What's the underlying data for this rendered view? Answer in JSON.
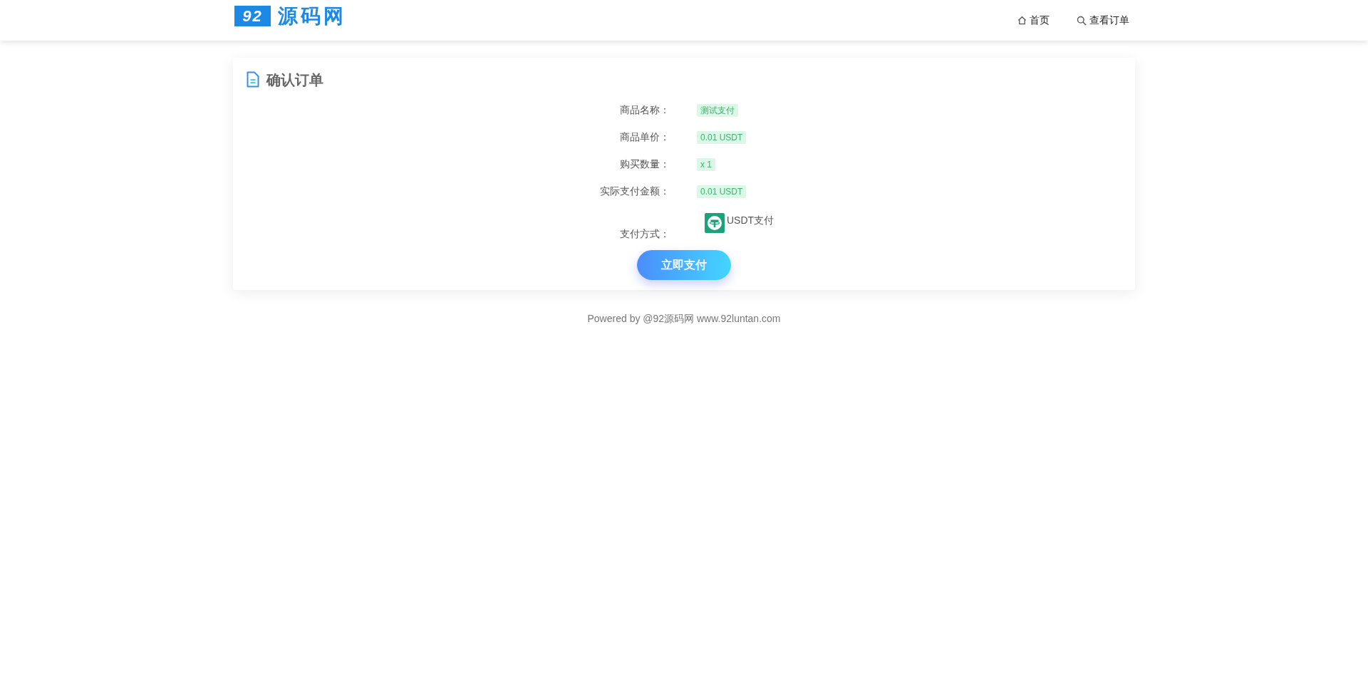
{
  "header": {
    "logo_badge": "92",
    "logo_text": "源码网",
    "nav": [
      {
        "kind": "home",
        "label": "首页"
      },
      {
        "kind": "search",
        "label": "查看订单"
      }
    ]
  },
  "card": {
    "title": "确认订单",
    "rows": [
      {
        "label": "商品名称：",
        "value": "测试支付"
      },
      {
        "label": "商品单价：",
        "value": "0.01 USDT"
      },
      {
        "label": "购买数量：",
        "value": "x 1"
      },
      {
        "label": "实际支付金额：",
        "value": "0.01 USDT"
      }
    ],
    "payment": {
      "label": "支付方式：",
      "method": "USDT支付"
    },
    "button": "立即支付"
  },
  "footer": "Powered by @92源码网 www.92luntan.com"
}
